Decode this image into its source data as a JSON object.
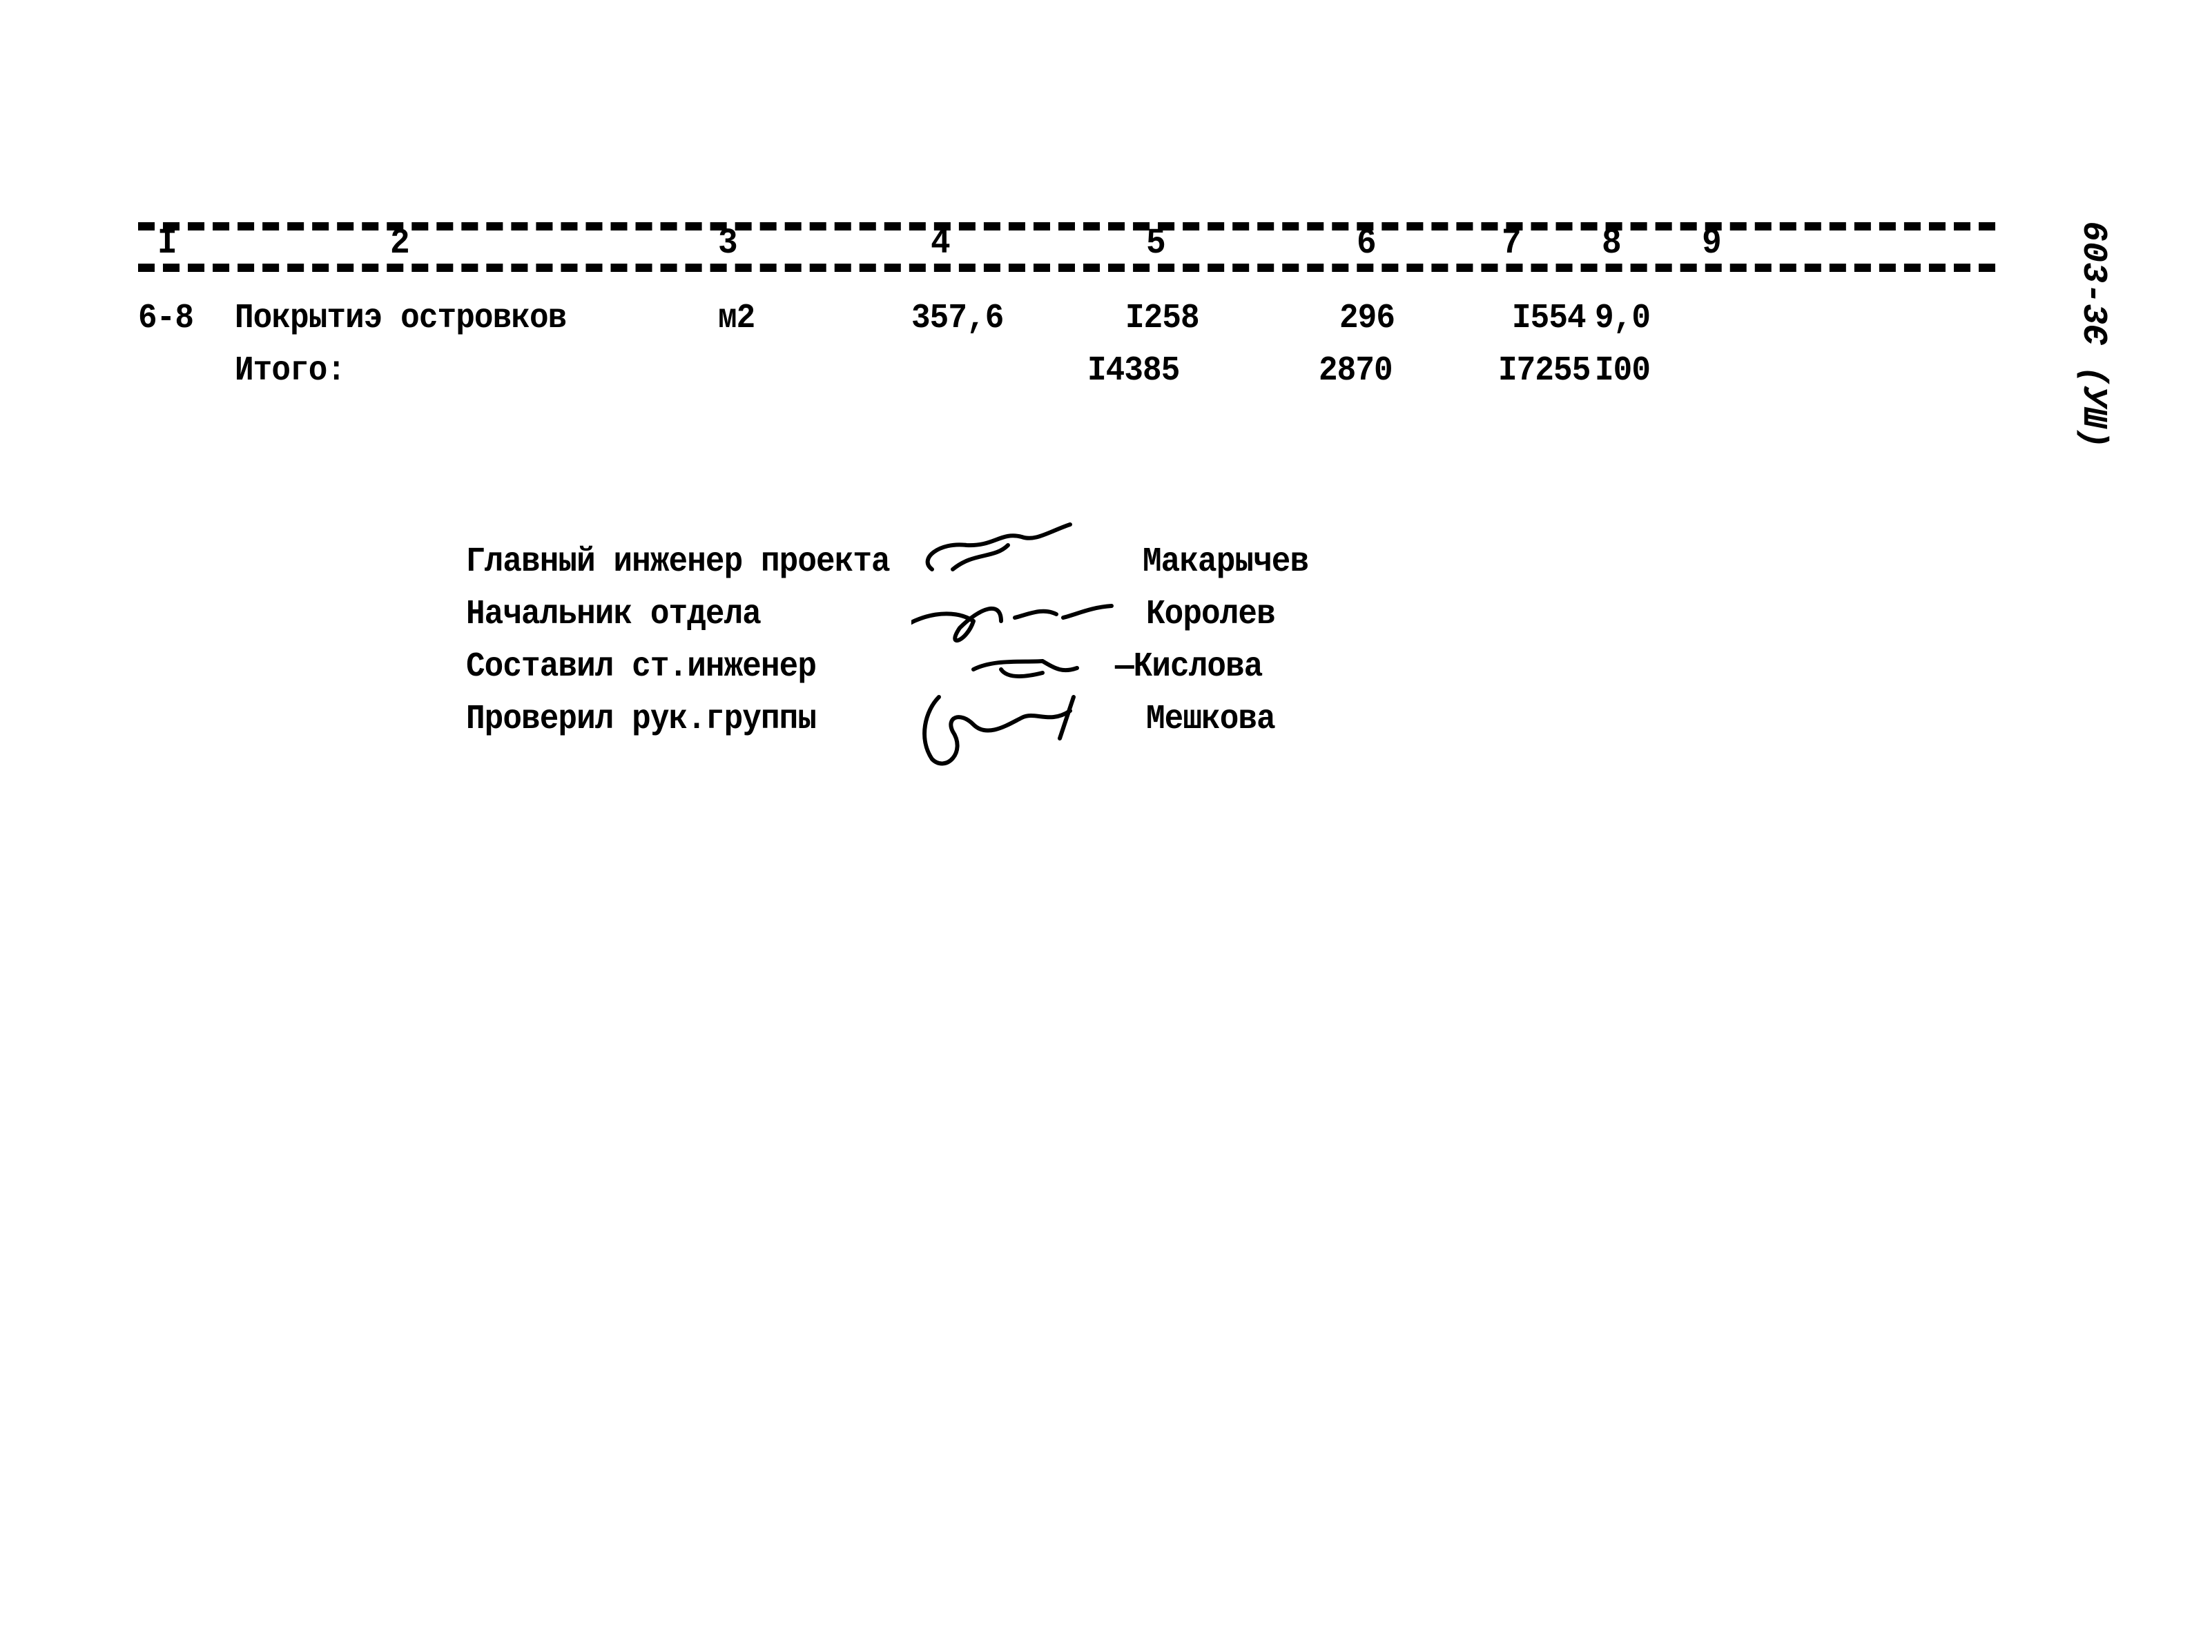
{
  "table": {
    "column_numbers": [
      "I",
      "2",
      "3",
      "4",
      "5",
      "6",
      "7",
      "8",
      "9"
    ],
    "rows": [
      {
        "code": "6-8",
        "name": "Покрытиэ островков",
        "unit": "м2",
        "quantity": "357,6",
        "col5": "I258",
        "col6": "296",
        "col7": "I554",
        "col8": "9,0",
        "col9": ""
      }
    ],
    "total": {
      "label": "Итого:",
      "col5": "I4385",
      "col6": "2870",
      "col7": "I7255",
      "col8": "I00"
    }
  },
  "signatures": [
    {
      "role": "Главный инженер проекта",
      "name": "Макарычев"
    },
    {
      "role": "Начальник отдела",
      "name": "Королев"
    },
    {
      "role": "Составил ст.инженер",
      "name": "—Кислова"
    },
    {
      "role": "Проверил рук.группы",
      "name": "Мешкова"
    }
  ],
  "margin_code": "603-3Є (УШ)"
}
